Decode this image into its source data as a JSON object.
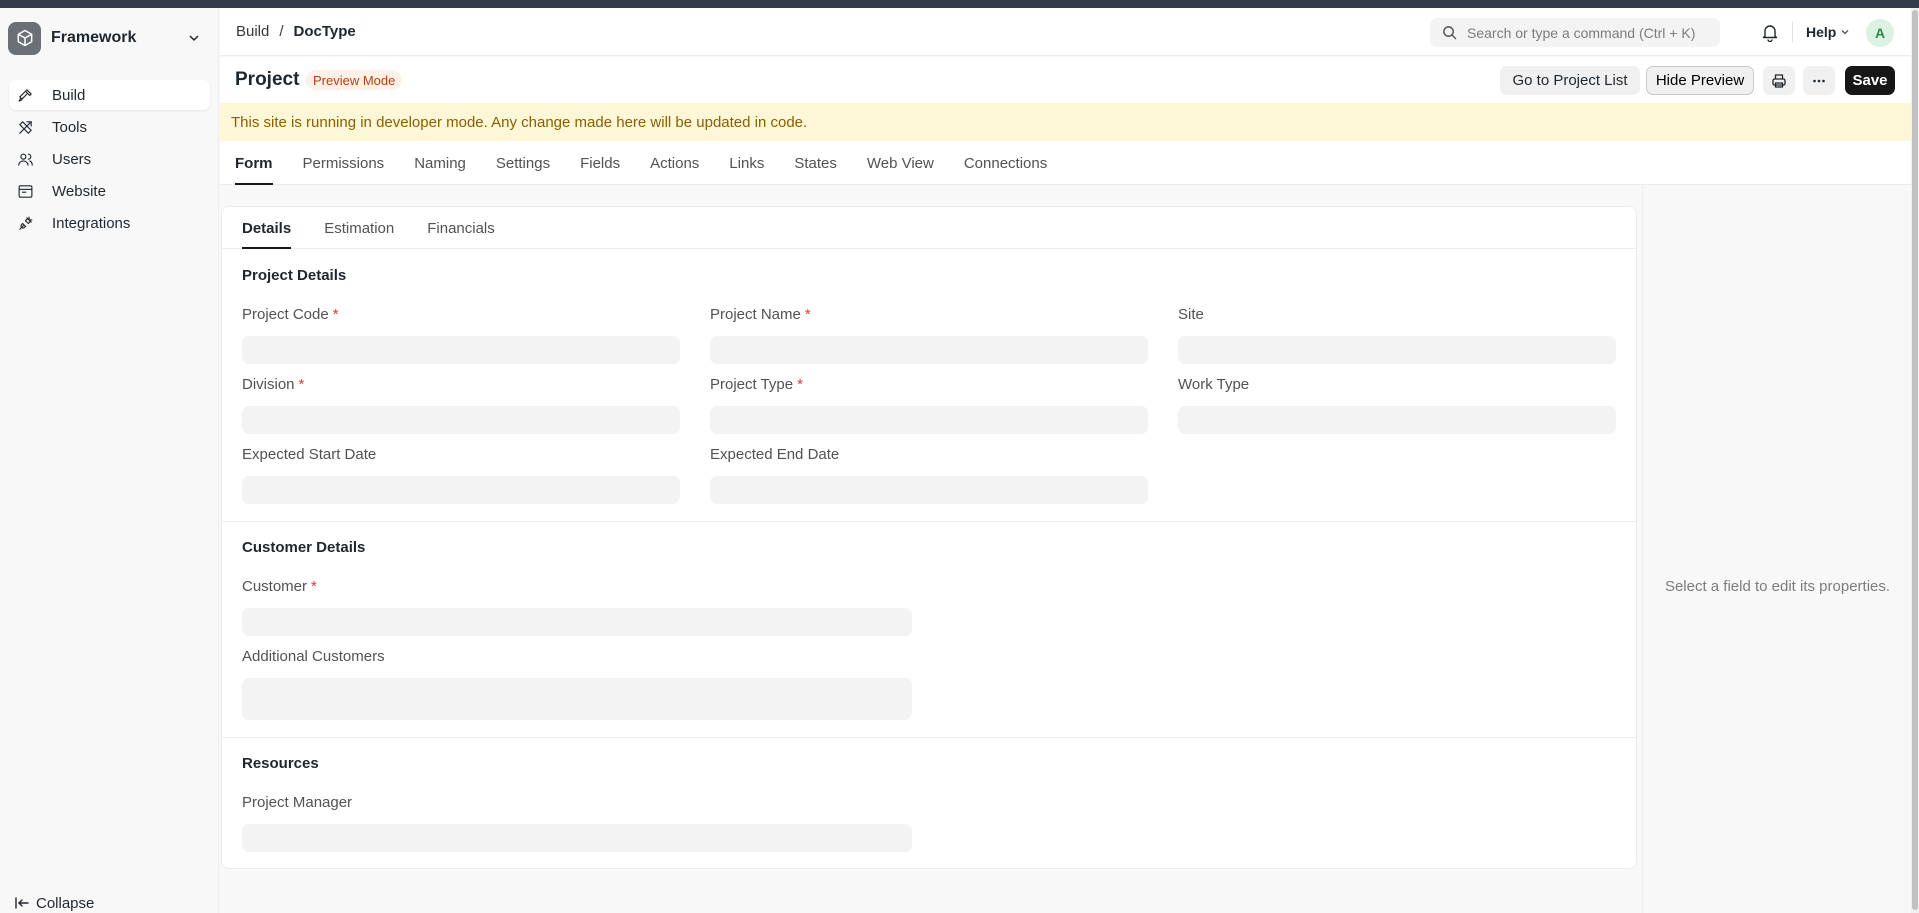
{
  "app": {
    "name": "Framework"
  },
  "sidebar": {
    "items": [
      {
        "label": "Build",
        "icon": "hammer-icon",
        "active": true
      },
      {
        "label": "Tools",
        "icon": "tools-icon",
        "active": false
      },
      {
        "label": "Users",
        "icon": "users-icon",
        "active": false
      },
      {
        "label": "Website",
        "icon": "website-icon",
        "active": false
      },
      {
        "label": "Integrations",
        "icon": "integrations-icon",
        "active": false
      }
    ],
    "collapse_label": "Collapse"
  },
  "header": {
    "breadcrumb": [
      "Build",
      "DocType"
    ],
    "breadcrumb_separator": "/",
    "search_placeholder": "Search or type a command (Ctrl + K)",
    "help_label": "Help",
    "avatar_initial": "A"
  },
  "page": {
    "title": "Project",
    "badge": "Preview Mode",
    "buttons": {
      "go_to_list": "Go to Project List",
      "hide_preview": "Hide Preview",
      "save": "Save"
    }
  },
  "alert": {
    "text": "This site is running in developer mode. Any change made here will be updated in code."
  },
  "doctype_tabs": [
    "Form",
    "Permissions",
    "Naming",
    "Settings",
    "Fields",
    "Actions",
    "Links",
    "States",
    "Web View",
    "Connections"
  ],
  "doctype_tab_active": "Form",
  "form": {
    "tabs": [
      "Details",
      "Estimation",
      "Financials"
    ],
    "active_tab": "Details",
    "sections": {
      "project_details": {
        "title": "Project Details",
        "fields": {
          "project_code": {
            "label": "Project Code",
            "required": true
          },
          "project_name": {
            "label": "Project Name",
            "required": true
          },
          "site": {
            "label": "Site",
            "required": false
          },
          "division": {
            "label": "Division",
            "required": true
          },
          "project_type": {
            "label": "Project Type",
            "required": true
          },
          "work_type": {
            "label": "Work Type",
            "required": false
          },
          "expected_start_date": {
            "label": "Expected Start Date",
            "required": false
          },
          "expected_end_date": {
            "label": "Expected End Date",
            "required": false
          }
        }
      },
      "customer_details": {
        "title": "Customer Details",
        "fields": {
          "customer": {
            "label": "Customer",
            "required": true
          },
          "additional_customers": {
            "label": "Additional Customers",
            "required": false
          }
        }
      },
      "resources": {
        "title": "Resources",
        "fields": {
          "project_manager": {
            "label": "Project Manager",
            "required": false
          }
        }
      }
    },
    "required_mark": "*"
  },
  "properties_panel": {
    "hint": "Select a field to edit its properties."
  },
  "colors": {
    "accent": "#171717",
    "badge_bg": "#fff1e7",
    "badge_text": "#bd3e0c",
    "alert_bg": "#fdf6d7",
    "alert_text": "#8a6000",
    "required": "#e03636"
  }
}
